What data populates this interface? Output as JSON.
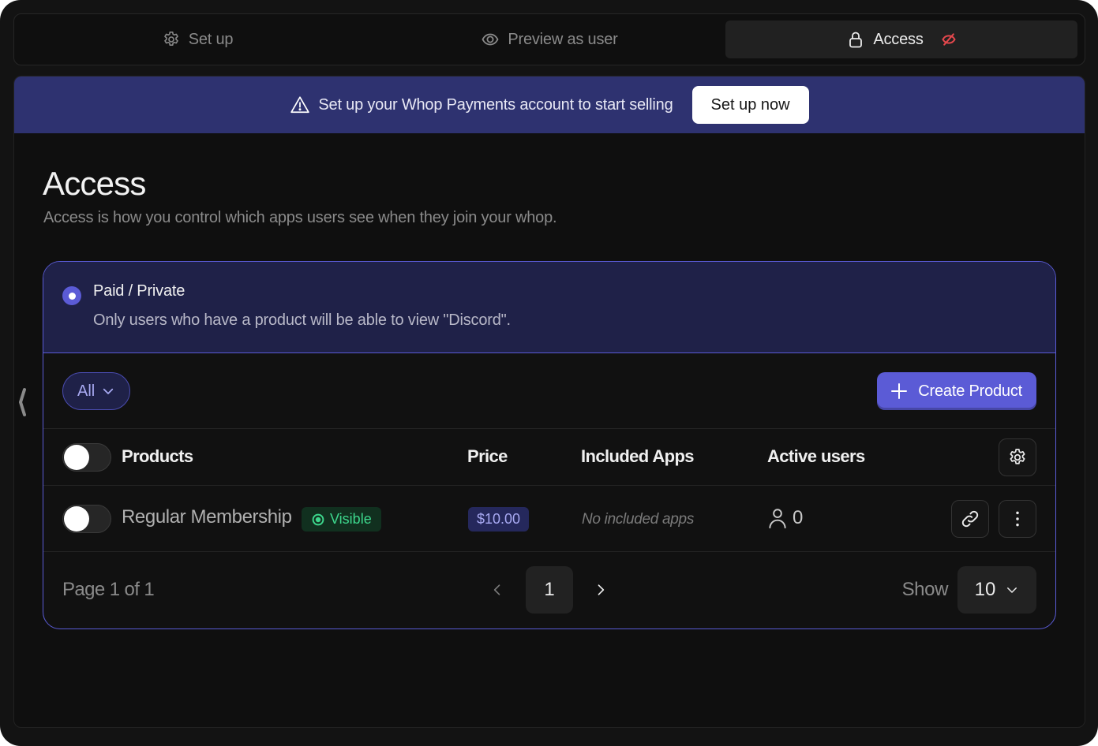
{
  "tabs": [
    {
      "label": "Set up",
      "icon": "gear-icon",
      "active": false
    },
    {
      "label": "Preview as user",
      "icon": "eye-icon",
      "active": false
    },
    {
      "label": "Access",
      "icon": "lock-icon",
      "active": true,
      "status_icon": "eye-off-icon"
    }
  ],
  "banner": {
    "icon": "warning-icon",
    "text": "Set up your Whop Payments account to start selling",
    "button_label": "Set up now"
  },
  "page": {
    "title": "Access",
    "subtitle": "Access is how you control which apps users see when they join your whop."
  },
  "access_mode": {
    "selected": true,
    "title": "Paid / Private",
    "description": "Only users who have a product will be able to view \"Discord\"."
  },
  "filter": {
    "label": "All"
  },
  "create_button": {
    "label": "Create Product"
  },
  "table": {
    "columns": [
      "Products",
      "Price",
      "Included Apps",
      "Active users"
    ],
    "rows": [
      {
        "name": "Regular Membership",
        "visibility": "Visible",
        "price": "$10.00",
        "included_apps": "No included apps",
        "active_users": "0"
      }
    ]
  },
  "pagination": {
    "info": "Page 1 of 1",
    "current_page": "1",
    "show_label": "Show",
    "page_size": "10"
  },
  "colors": {
    "accent": "#5b5bd6",
    "banner_bg": "#2e3270",
    "visible_green": "#3dd68c",
    "hidden_red": "#e5484d"
  }
}
